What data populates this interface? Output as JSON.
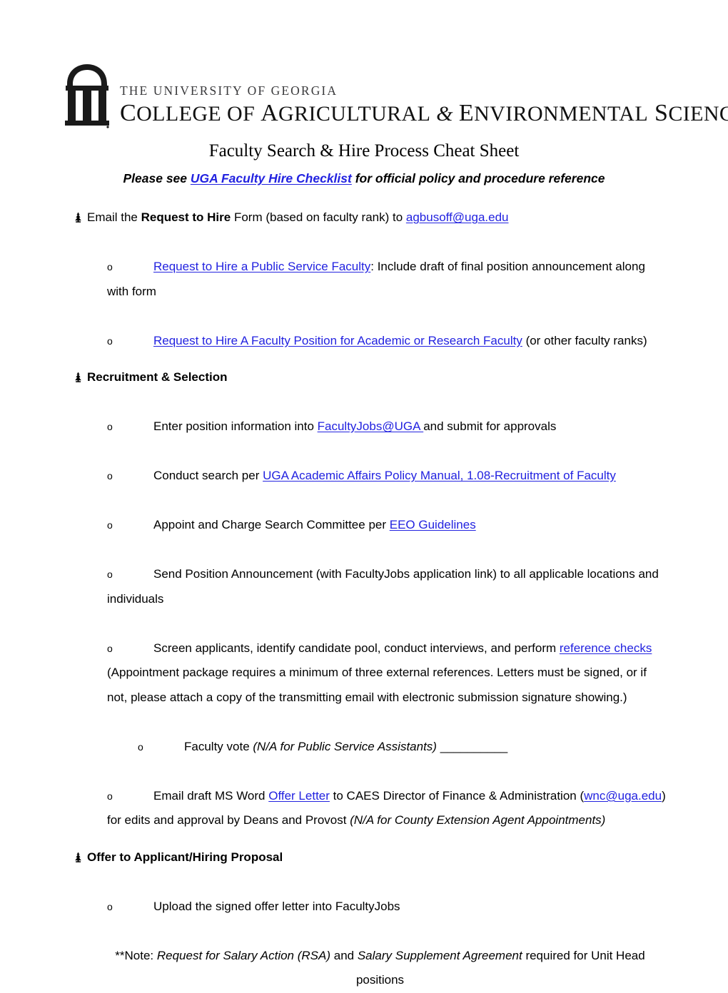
{
  "logo": {
    "arch_icon": "uga-arch-icon",
    "line1": "THE UNIVERSITY OF GEORGIA",
    "line2_a": "C",
    "line2_b": "OLLEGE",
    "line2_c": " OF ",
    "line2_d": "A",
    "line2_e": "GRICULTURAL",
    "line2_amp": " & ",
    "line2_f": "E",
    "line2_g": "NVIRONMENTAL",
    "line2_h": " S",
    "line2_i": "CIENCES"
  },
  "title": "Faculty Search & Hire Process Cheat Sheet",
  "subtitle": {
    "before": "Please see ",
    "link": "UGA Faculty Hire Checklist",
    "after": " for official policy and procedure reference"
  },
  "sections": {
    "request_to_hire": {
      "marker": "pine-tree-bullet",
      "text_before_bold": "Email the ",
      "bold": "Request to Hire",
      "text_after_bold": " Form (based on faculty rank) to ",
      "email_link": "agbusoff@uga.edu"
    },
    "rth_sub_1": {
      "marker": "o",
      "link": "Request to Hire a Public Service Faculty",
      "after": ": Include draft of final position announcement along",
      "wrap": "with form"
    },
    "rth_sub_2": {
      "marker": "o",
      "link": "Request to Hire A Faculty Position for Academic or Research Faculty",
      "after": " (or other faculty ranks)"
    },
    "recruitment_heading": {
      "marker": "pine-tree-bullet",
      "text": "Recruitment & Selection"
    },
    "rec_sub_1": {
      "marker": "o",
      "before": "Enter position information into ",
      "link": "FacultyJobs@UGA ",
      "after": "and submit for approvals"
    },
    "rec_sub_2": {
      "marker": "o",
      "before": "Conduct search per ",
      "link": "UGA Academic Affairs Policy Manual, 1.08-Recruitment of Faculty",
      "after": ""
    },
    "rec_sub_3": {
      "marker": "o",
      "before": "Appoint and Charge Search Committee per ",
      "link": "EEO Guidelines",
      "after": ""
    },
    "rec_sub_4": {
      "marker": "o",
      "text": "Send Position Announcement (with FacultyJobs application link) to all applicable locations and",
      "wrap": "individuals"
    },
    "rec_sub_5": {
      "marker": "o",
      "before": "Screen applicants, identify candidate pool, conduct interviews, and perform ",
      "link": "reference checks",
      "wrap1": "(Appointment package requires a minimum of three external references. Letters must be signed, or if",
      "wrap2": "not, please attach a copy of the transmitting email with electronic submission signature showing.)"
    },
    "faculty_vote": {
      "marker": "o",
      "before": "Faculty vote ",
      "italic": "(N/A for Public Service Assistants)",
      "blank": " __________"
    },
    "offer_letter_sub": {
      "marker": "o",
      "before": "Email draft MS Word ",
      "link": "Offer Letter",
      "mid": " to CAES Director of Finance & Administration (",
      "email_link": "wnc@uga.edu",
      "after": ")",
      "wrap_before": "for edits and approval by Deans and Provost ",
      "wrap_italic": "(N/A for County Extension Agent Appointments)"
    },
    "offer_heading": {
      "marker": "pine-tree-bullet",
      "text": "Offer to Applicant/Hiring Proposal"
    },
    "offer_sub_1": {
      "marker": "o",
      "text": "Upload the signed offer letter into FacultyJobs"
    },
    "final_note": {
      "prefix": "**Note:  ",
      "italic1": "Request for Salary Action (RSA)",
      "mid": " and ",
      "italic2": "Salary Supplement Agreement",
      "after": " required for Unit Head",
      "wrap": "positions"
    }
  },
  "colors": {
    "link": "#2222e0",
    "text": "#000000",
    "logo_subtext": "#3a3a3c",
    "page_bg": "#ffffff"
  }
}
